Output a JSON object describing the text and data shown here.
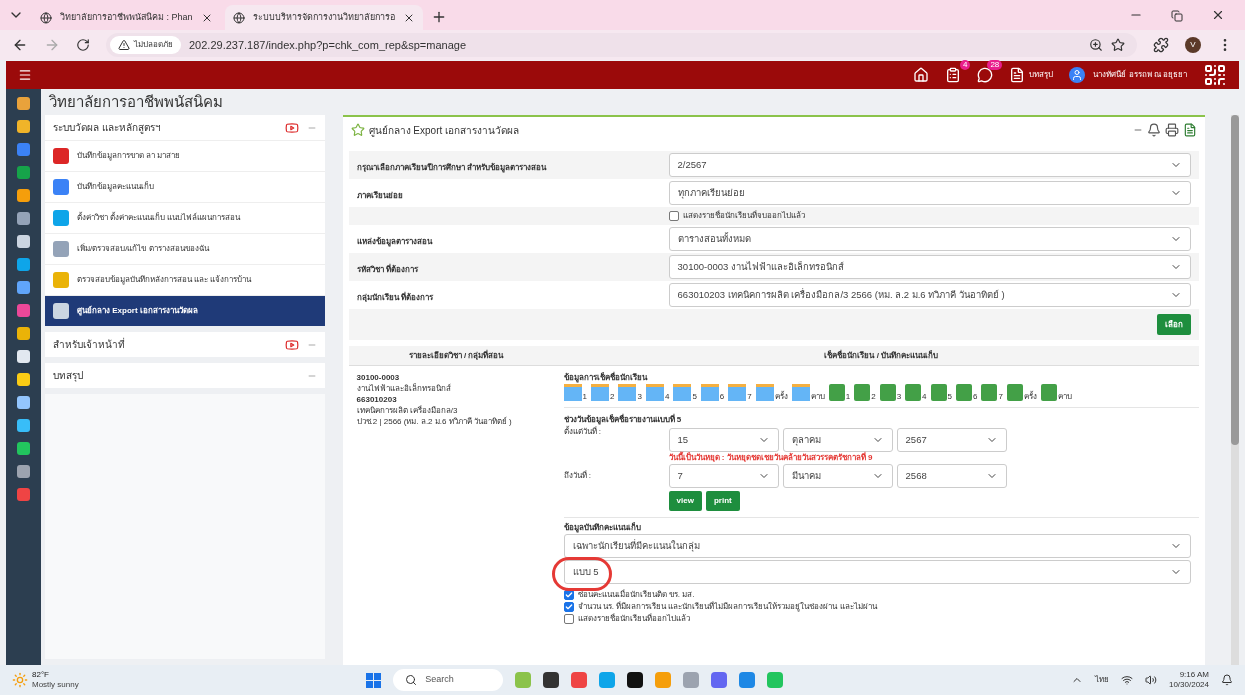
{
  "browser": {
    "tabs": [
      {
        "title": "วิทยาลัยการอาชีพพนัสนิคม : Phan",
        "selected": false
      },
      {
        "title": "ระบบบริหารจัดการงานวิทยาลัยการอ",
        "selected": true
      }
    ],
    "security_label": "ไม่ปลอดภัย",
    "url": "202.29.237.187/index.php?p=chk_com_rep&sp=manage",
    "profile_initial": "V"
  },
  "header": {
    "badges": [
      "4",
      "28"
    ],
    "summary_link": "บทสรุป",
    "user_name": "นางทัศนีย์ อรรถพ ณ อยุธยา"
  },
  "college_name": "วิทยาลัยการอาชีพพนัสนิคม",
  "sidebar": {
    "sections": [
      {
        "title": "ระบบวัดผล และหลักสูตรฯ",
        "video": true,
        "items": [
          {
            "label": "บันทึกข้อมูลการขาด ลา มาสาย",
            "selected": false
          },
          {
            "label": "บันทึกข้อมูลคะแนนเก็บ",
            "selected": false
          },
          {
            "label": "ตั้งค่าวิชา ตั้งค่าคะแนนเก็บ แนบไฟล์แผนการสอน",
            "selected": false
          },
          {
            "label": "เพิ่ม/ตรวจสอบ/แก้ไข ตารางสอนของฉัน",
            "selected": false
          },
          {
            "label": "ตรวจสอบข้อมูลบันทึกหลังการสอน และ แจ้งการบ้าน",
            "selected": false
          },
          {
            "label": "ศูนย์กลาง Export เอกสารงานวัดผล",
            "selected": true
          }
        ]
      },
      {
        "title": "สำหรับเจ้าหน้าที่",
        "video": true
      },
      {
        "title": "บทสรุป",
        "video": false
      }
    ]
  },
  "panel": {
    "title": "ศูนย์กลาง Export เอกสารงานวัดผล",
    "form_rows": [
      {
        "kind": "select",
        "label": "กรุณาเลือกภาคเรียน/ปีการศึกษา สำหรับข้อมูลตารางสอน",
        "value": "2/2567"
      },
      {
        "kind": "select",
        "label": "ภาคเรียนย่อย",
        "value": "ทุกภาคเรียนย่อย"
      },
      {
        "kind": "checkbox",
        "label": "แสดงรายชื่อนักเรียนที่จบออกไปแล้ว",
        "checked": false
      },
      {
        "kind": "select",
        "label": "แหล่งข้อมูลตารางสอน",
        "value": "ตารางสอนทั้งหมด"
      },
      {
        "kind": "select",
        "label": "รหัสวิชา ที่ต้องการ",
        "value": "30100-0003 งานไฟฟ้าและอิเล็กทรอนิกส์"
      },
      {
        "kind": "select",
        "label": "กลุ่มนักเรียน ที่ต้องการ",
        "value": "663010203 เทคนิคการผลิต เครื่องมือกล/3 2566 (หม. ล.2 ม.6 ทวิภาคี วันอาทิตย์ )"
      }
    ],
    "choose_button": "เลือก"
  },
  "table": {
    "columns": [
      "รายละเอียดวิชา / กลุ่มที่สอน",
      "เช็คชื่อนักเรียน / บันทึกคะแนนเก็บ"
    ],
    "subject_lines": [
      "30100-0003",
      "งานไฟฟ้าและอิเล็กทรอนิกส์",
      "663010203",
      "เทคนิคการผลิต เครื่องมือกล/3",
      "ปวช.2 | 2566 (หม. ล.2 ม.6 ทวิภาคี วันอาทิตย์ )"
    ],
    "attendance": {
      "heading": "ข้อมูลการเช็คชื่อนักเรียน",
      "sheet_labels": [
        "1",
        "2",
        "3",
        "4",
        "5",
        "6",
        "7",
        "ครั้ง",
        "คาบ"
      ],
      "excel_labels": [
        "1",
        "2",
        "3",
        "4",
        "5",
        "6",
        "7",
        "ครั้ง",
        "คาบ"
      ]
    },
    "date_range": {
      "heading": "ช่วงวันข้อมูลเช็คชื่อรายงานแบบที่ 5",
      "from_label": "ตั้งแต่วันที่ :",
      "from": [
        "15",
        "ตุลาคม",
        "2567"
      ],
      "holiday_note": "วันนี้เป็นวันหยุด : วันหยุดชดเชยวันคล้ายวันสวรรคตรัชกาลที่ 9",
      "to_label": "ถึงวันที่ :",
      "to": [
        "7",
        "มีนาคม",
        "2568"
      ],
      "buttons": [
        "view",
        "print"
      ]
    },
    "scores": {
      "heading": "ข้อมูลบันทึกคะแนนเก็บ",
      "selects": [
        "เฉพาะนักเรียนที่มีคะแนนในกลุ่ม",
        "แบบ 5"
      ],
      "options": [
        {
          "label": "ซ่อนคะแนนเมื่อนักเรียนติด ขร. มส.",
          "checked": true
        },
        {
          "label": "จำนวน นร. ที่มีผลการเรียน และนักเรียนที่ไม่มีผลการเรียนให้รวมอยู่ในช่องผ่าน และไม่ผ่าน",
          "checked": true
        },
        {
          "label": "แสดงรายชื่อนักเรียนที่ออกไปแล้ว",
          "checked": false
        }
      ]
    }
  },
  "taskbar": {
    "temperature": "82°F",
    "weather": "Mostly sunny",
    "search_placeholder": "Search",
    "language": "ไทย",
    "time": "9:16 AM",
    "date": "10/30/2024"
  }
}
